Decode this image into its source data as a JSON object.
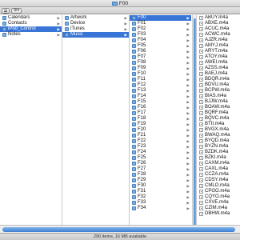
{
  "window": {
    "title": "F00"
  },
  "status": {
    "text": "290 items, 16 MB available"
  },
  "columns": {
    "library": [
      {
        "label": "Calendars",
        "icon": "folder-icon"
      },
      {
        "label": "Contacts",
        "icon": "folder-icon"
      },
      {
        "label": "iPod_Control",
        "icon": "folder-icon",
        "selected": true
      },
      {
        "label": "Notes",
        "icon": "folder-icon"
      }
    ],
    "ipod_control": [
      {
        "label": "Artwork",
        "icon": "folder-icon"
      },
      {
        "label": "Device",
        "icon": "folder-icon"
      },
      {
        "label": "iTunes",
        "icon": "folder-icon"
      },
      {
        "label": "Music",
        "icon": "folder-icon",
        "selected": true
      }
    ],
    "music": [
      "F00",
      "F01",
      "F02",
      "F03",
      "F04",
      "F05",
      "F06",
      "F07",
      "F08",
      "F09",
      "F10",
      "F11",
      "F12",
      "F13",
      "F14",
      "F15",
      "F16",
      "F17",
      "F18",
      "F19",
      "F20",
      "F21",
      "F22",
      "F23",
      "F24",
      "F25",
      "F26",
      "F27",
      "F28",
      "F29",
      "F30",
      "F31",
      "F32",
      "F33",
      "F34"
    ],
    "files": [
      "ABUY.m4a",
      "ABXE.m4a",
      "ACUC.m4a",
      "ACWC.m4a",
      "AJZR.m4a",
      "AMYJ.m4a",
      "ARYT.m4a",
      "ATOY.m4a",
      "AWEI.m4a",
      "AZSS.m4a",
      "BAEJ.m4a",
      "BDQR.m4a",
      "BDVU.m4a",
      "BCPW.m4a",
      "BIAS.m4a",
      "BJJW.m4a",
      "BOAW.m4a",
      "BQRF.m4a",
      "BQVC.m4a",
      "BTII.m4a",
      "BVGX.m4a",
      "BWAQ.m4a",
      "BYQD.m4a",
      "BYZN.m4a",
      "BZDK.m4a",
      "BZKI.m4a",
      "CAXM.m4a",
      "CAXL.m4a",
      "CCZA.m4a",
      "CDSY.m4a",
      "CMLO.m4a",
      "CPGO.m4a",
      "CQYO.m4a",
      "CXVE.m4a",
      "CZIM.m4a",
      "DBHW.m4a"
    ]
  }
}
